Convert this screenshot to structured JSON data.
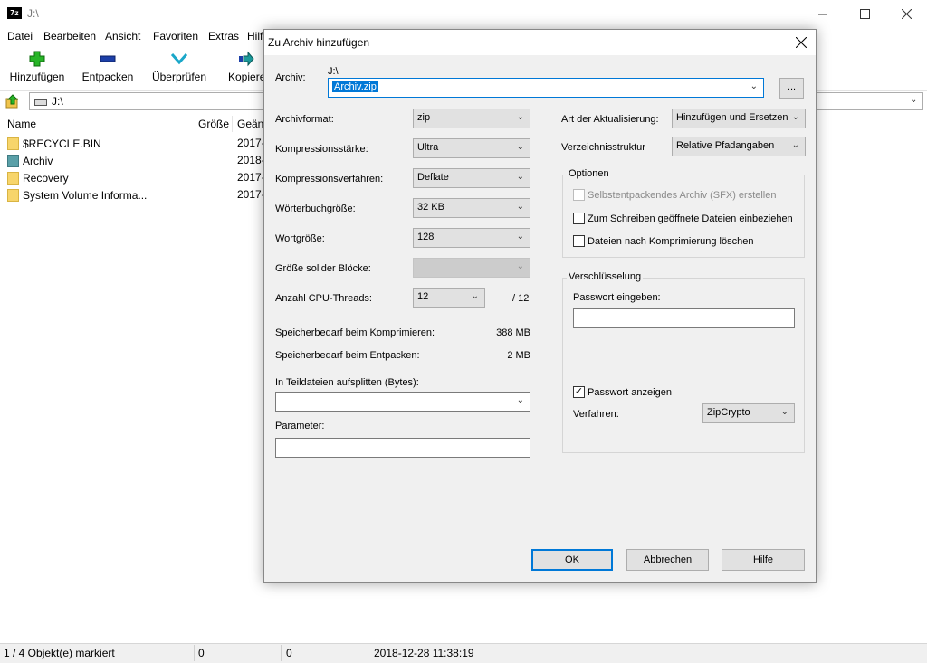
{
  "window": {
    "app_icon": "7z",
    "title": "J:\\",
    "minimize_icon": "minimize-icon",
    "maximize_icon": "maximize-icon",
    "close_icon": "close-icon"
  },
  "menu": [
    "Datei",
    "Bearbeiten",
    "Ansicht",
    "Favoriten",
    "Extras",
    "Hilfe"
  ],
  "toolbar": {
    "add": {
      "label": "Hinzufügen",
      "icon": "plus-icon",
      "color": "#27b527"
    },
    "extract": {
      "label": "Entpacken",
      "icon": "minus-icon",
      "color": "#1c3fa8"
    },
    "test": {
      "label": "Überprüfen",
      "icon": "check-down-icon",
      "color": "#1aa7c9"
    },
    "copy": {
      "label": "Kopieren",
      "icon": "arrow-right-icon",
      "color": "#1b9a9a"
    }
  },
  "address": {
    "path": "J:\\",
    "up_icon": "folder-up-icon"
  },
  "list": {
    "columns": [
      "Name",
      "Größe",
      "Geänd"
    ],
    "rows": [
      {
        "name": "$RECYCLE.BIN",
        "date": "2017-"
      },
      {
        "name": "Archiv",
        "date": "2018-"
      },
      {
        "name": "Recovery",
        "date": "2017-"
      },
      {
        "name": "System Volume Informa...",
        "date": "2017-"
      }
    ]
  },
  "status": {
    "selection": "1 / 4 Objekt(e) markiert",
    "size1": "0",
    "size2": "0",
    "datetime": "2018-12-28 11:38:19"
  },
  "dialog": {
    "title": "Zu Archiv hinzufügen",
    "archive_label": "Archiv:",
    "archive_dir": "J:\\",
    "archive_name": "Archiv.zip",
    "browse_label": "...",
    "format_label": "Archivformat:",
    "format_value": "zip",
    "level_label": "Kompressionsstärke:",
    "level_value": "Ultra",
    "method_label": "Kompressionsverfahren:",
    "method_value": "Deflate",
    "dict_label": "Wörterbuchgröße:",
    "dict_value": "32 KB",
    "word_label": "Wortgröße:",
    "word_value": "128",
    "solid_label": "Größe solider Blöcke:",
    "threads_label": "Anzahl CPU-Threads:",
    "threads_value": "12",
    "threads_max": "/ 12",
    "mem_comp_label": "Speicherbedarf beim Komprimieren:",
    "mem_comp_value": "388 MB",
    "mem_decomp_label": "Speicherbedarf beim Entpacken:",
    "mem_decomp_value": "2 MB",
    "split_label": "In Teildateien aufsplitten (Bytes):",
    "split_value": "",
    "params_label": "Parameter:",
    "params_value": "",
    "update_label": "Art der Aktualisierung:",
    "update_value": "Hinzufügen und Ersetzen",
    "paths_label": "Verzeichnisstruktur",
    "paths_value": "Relative Pfadangaben",
    "options_group": "Optionen",
    "opt_sfx": "Selbstentpackendes Archiv (SFX) erstellen",
    "opt_shared": "Zum Schreiben geöffnete Dateien einbeziehen",
    "opt_delete": "Dateien nach Komprimierung löschen",
    "encryption_group": "Verschlüsselung",
    "password_label": "Passwort eingeben:",
    "password_value": "",
    "show_password_label": "Passwort anzeigen",
    "show_password_checked": true,
    "enc_method_label": "Verfahren:",
    "enc_method_value": "ZipCrypto",
    "ok_label": "OK",
    "cancel_label": "Abbrechen",
    "help_label": "Hilfe"
  }
}
